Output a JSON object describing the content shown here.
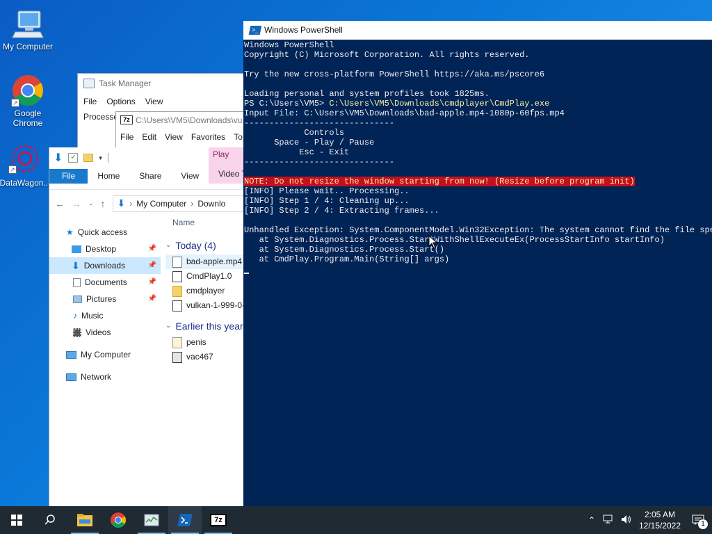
{
  "desktop": {
    "icons": [
      {
        "label": "My Computer"
      },
      {
        "label": "Google Chrome"
      },
      {
        "label": "DataWagon..."
      }
    ]
  },
  "task_manager": {
    "title": "Task Manager",
    "menu": [
      "File",
      "Options",
      "View"
    ],
    "tab": "Processe"
  },
  "sevenzip": {
    "title": "C:\\Users\\VM5\\Downloads\\vu",
    "menu": [
      "File",
      "Edit",
      "View",
      "Favorites",
      "To"
    ]
  },
  "explorer": {
    "play_tab": "Play",
    "ribbon_tabs": [
      "File",
      "Home",
      "Share",
      "View",
      "Video T"
    ],
    "address": [
      "My Computer",
      "Downlo"
    ],
    "nav": [
      {
        "label": "Quick access"
      },
      {
        "label": "Desktop"
      },
      {
        "label": "Downloads"
      },
      {
        "label": "Documents"
      },
      {
        "label": "Pictures"
      },
      {
        "label": "Music"
      },
      {
        "label": "Videos"
      },
      {
        "label": "My Computer"
      },
      {
        "label": "Network"
      }
    ],
    "column_name": "Name",
    "groups": [
      {
        "label": "Today (4)",
        "files": [
          "bad-apple.mp4",
          "CmdPlay1.0",
          "cmdplayer",
          "vulkan-1-999-0-"
        ]
      },
      {
        "label": "Earlier this year",
        "files": [
          "penis",
          "vac467"
        ]
      }
    ]
  },
  "powershell": {
    "title": "Windows PowerShell",
    "lines": [
      "Windows PowerShell",
      "Copyright (C) Microsoft Corporation. All rights reserved.",
      "",
      "Try the new cross-platform PowerShell https://aka.ms/pscore6",
      "",
      "Loading personal and system profiles took 1825ms.",
      "Input File: C:\\Users\\VM5\\Downloads\\bad-apple.mp4-1080p-60fps.mp4",
      "------------------------------",
      "            Controls",
      "      Space - Play / Pause",
      "           Esc - Exit",
      "------------------------------",
      "",
      "[INFO] Please wait.. Processing..",
      "[INFO] Step 1 / 4: Cleaning up...",
      "[INFO] Step 2 / 4: Extracting frames...",
      "",
      "Unhandled Exception: System.ComponentModel.Win32Exception: The system cannot find the file speci",
      "   at System.Diagnostics.Process.StartWithShellExecuteEx(ProcessStartInfo startInfo)",
      "   at System.Diagnostics.Process.Start()",
      "   at CmdPlay.Program.Main(String[] args)"
    ],
    "prompt": "PS C:\\Users\\VM5> ",
    "command": "C:\\Users\\VM5\\Downloads\\cmdplayer\\CmdPlay.exe",
    "warning": "NOTE: Do not resize the window starting from now! (Resize before program init)"
  },
  "taskbar": {
    "time": "2:05 AM",
    "date": "12/15/2022",
    "notification_count": "1"
  },
  "colors": {
    "ps_background": "#012456",
    "ps_text": "#eeedf0",
    "ps_yellow": "#f9f1a5",
    "warning_bg": "#c50f1f",
    "explorer_accent": "#1979ca",
    "taskbar": "#1f2a33"
  }
}
